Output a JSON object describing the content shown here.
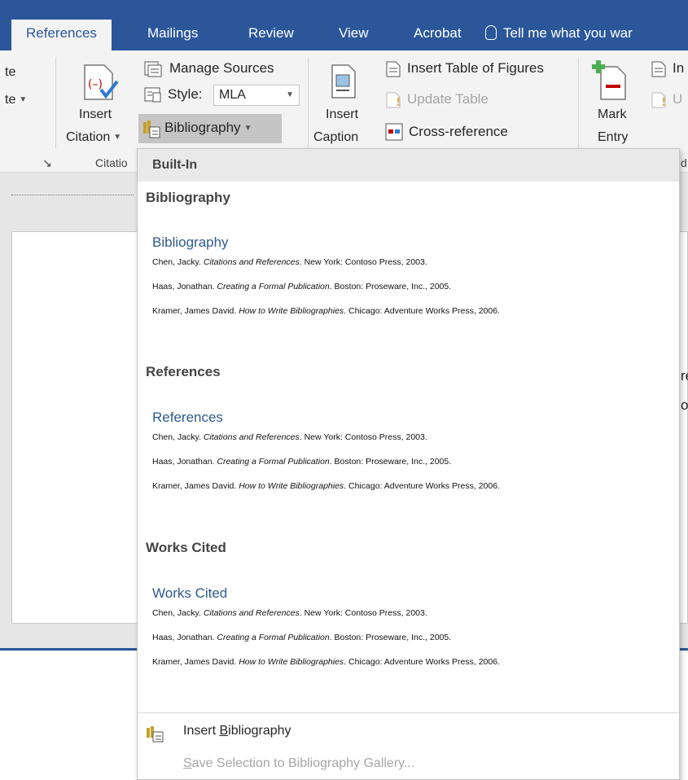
{
  "tabs": {
    "references": "References",
    "mailings": "Mailings",
    "review": "Review",
    "view": "View",
    "acrobat": "Acrobat",
    "tell_me": "Tell me what you war"
  },
  "ribbon": {
    "partial_left_1": "te",
    "partial_left_2": "te",
    "insert_citation_line1": "Insert",
    "insert_citation_line2": "Citation",
    "manage_sources": "Manage Sources",
    "style_label": "Style:",
    "style_value": "MLA",
    "bibliography": "Bibliography",
    "group_citations": "Citatio",
    "insert_caption_line1": "Insert",
    "insert_caption_line2": "Caption",
    "insert_table_of_figures": "Insert Table of Figures",
    "update_table": "Update Table",
    "cross_reference": "Cross-reference",
    "mark_entry_line1": "Mark",
    "mark_entry_line2": "Entry",
    "partial_right_1": "In",
    "partial_right_2": "U",
    "partial_group_right": "d"
  },
  "document": {
    "frag1": "re",
    "frag2": "o"
  },
  "gallery": {
    "header": "Built-In",
    "sections": [
      {
        "title": "Bibliography",
        "heading": "Bibliography",
        "entries": [
          {
            "author": "Chen, Jacky. ",
            "title": "Citations and References",
            "rest": ". New York: Contoso Press, 2003."
          },
          {
            "author": "Haas, Jonathan. ",
            "title": "Creating a Formal Publication",
            "rest": ". Boston: Proseware, Inc., 2005."
          },
          {
            "author": "Kramer, James David. ",
            "title": "How to Write Bibliographies",
            "rest": ". Chicago: Adventure Works Press, 2006."
          }
        ]
      },
      {
        "title": "References",
        "heading": "References",
        "entries": [
          {
            "author": "Chen, Jacky. ",
            "title": "Citations and References",
            "rest": ". New York: Contoso Press, 2003."
          },
          {
            "author": "Haas, Jonathan. ",
            "title": "Creating a Formal Publication",
            "rest": ". Boston: Proseware, Inc., 2005."
          },
          {
            "author": "Kramer, James David. ",
            "title": "How to Write Bibliographies",
            "rest": ". Chicago: Adventure Works Press, 2006."
          }
        ]
      },
      {
        "title": "Works Cited",
        "heading": "Works Cited",
        "entries": [
          {
            "author": "Chen, Jacky. ",
            "title": "Citations and References",
            "rest": ". New York: Contoso Press, 2003."
          },
          {
            "author": "Haas, Jonathan. ",
            "title": "Creating a Formal Publication",
            "rest": ". Boston: Proseware, Inc., 2005."
          },
          {
            "author": "Kramer, James David. ",
            "title": "How to Write Bibliographies",
            "rest": ". Chicago: Adventure Works Press, 2006."
          }
        ]
      }
    ],
    "insert_bibliography_pre": "Insert ",
    "insert_bibliography_ul": "B",
    "insert_bibliography_post": "ibliography",
    "save_selection_ul": "S",
    "save_selection_post": "ave Selection to Bibliography Gallery..."
  },
  "colors": {
    "tab_bar": "#2b579a",
    "ribbon_bg": "#f3f3f3",
    "gallery_heading": "#2e5a8f"
  }
}
